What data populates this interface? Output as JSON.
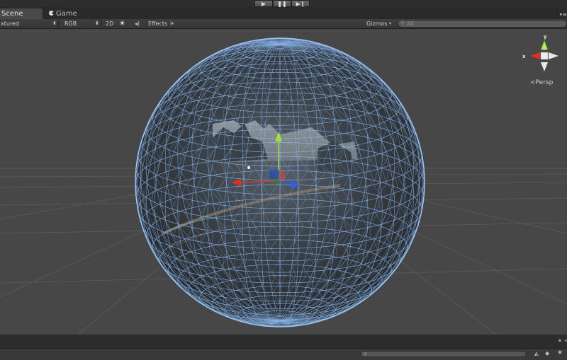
{
  "playbar": {
    "play_icon": "▶",
    "pause_icon": "❚❚",
    "step_icon": "▶❙"
  },
  "tabs": {
    "scene_label": "Scene",
    "game_label": "Game",
    "game_icon": "pacman-icon",
    "menu_icon": "▾≡"
  },
  "toolbar": {
    "render_mode": "xtured",
    "color_mode": "RGB",
    "mode_2d": "2D",
    "effects": "Effects",
    "gizmos": "Gizmos",
    "search_placeholder": "All"
  },
  "gizmo": {
    "x_label": "x",
    "y_label": "y",
    "projection": "Persp"
  },
  "colors": {
    "wire": "#8cb7ee",
    "x_axis": "#e0301e",
    "y_axis": "#9be33b",
    "z_axis": "#2e5fe6",
    "background": "#474747"
  }
}
